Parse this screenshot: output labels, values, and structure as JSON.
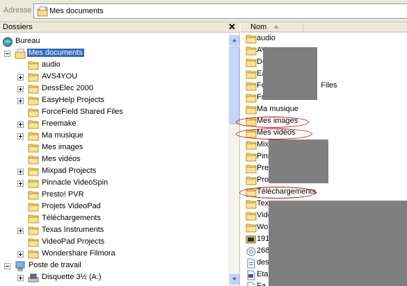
{
  "address": {
    "label": "Adresse",
    "path": "Mes documents"
  },
  "folders_pane": {
    "title": "Dossiers",
    "close": "✕"
  },
  "tree": [
    {
      "label": "Bureau",
      "icon": "desktop-icon",
      "expander": "none",
      "level": 0
    },
    {
      "label": "Mes documents",
      "icon": "my-documents-icon",
      "expander": "minus",
      "level": 1,
      "selected": true
    },
    {
      "label": "audio",
      "icon": "folder-icon",
      "expander": "none",
      "level": 2
    },
    {
      "label": "AVS4YOU",
      "icon": "folder-icon",
      "expander": "plus",
      "level": 2
    },
    {
      "label": "DessElec 2000",
      "icon": "folder-icon",
      "expander": "plus",
      "level": 2
    },
    {
      "label": "EasyHelp Projects",
      "icon": "folder-icon",
      "expander": "plus",
      "level": 2
    },
    {
      "label": "ForceField Shared Files",
      "icon": "folder-icon",
      "expander": "none",
      "level": 2
    },
    {
      "label": "Freemake",
      "icon": "folder-icon",
      "expander": "plus",
      "level": 2
    },
    {
      "label": "Ma musique",
      "icon": "music-folder-icon",
      "expander": "plus",
      "level": 2
    },
    {
      "label": "Mes images",
      "icon": "pictures-folder-icon",
      "expander": "none",
      "level": 2
    },
    {
      "label": "Mes vidéos",
      "icon": "videos-folder-icon",
      "expander": "none",
      "level": 2
    },
    {
      "label": "Mixpad Projects",
      "icon": "folder-icon",
      "expander": "plus",
      "level": 2
    },
    {
      "label": "Pinnacle VideoSpin",
      "icon": "folder-icon",
      "expander": "plus",
      "level": 2
    },
    {
      "label": "Presto! PVR",
      "icon": "folder-icon",
      "expander": "none",
      "level": 2
    },
    {
      "label": "Projets VideoPad",
      "icon": "folder-icon",
      "expander": "none",
      "level": 2
    },
    {
      "label": "Téléchargements",
      "icon": "folder-icon",
      "expander": "none",
      "level": 2
    },
    {
      "label": "Texas Instruments",
      "icon": "folder-icon",
      "expander": "plus",
      "level": 2
    },
    {
      "label": "VideoPad Projects",
      "icon": "folder-icon",
      "expander": "none",
      "level": 2
    },
    {
      "label": "Wondershare Filmora",
      "icon": "folder-icon",
      "expander": "plus",
      "level": 2
    },
    {
      "label": "Poste de travail",
      "icon": "computer-icon",
      "expander": "minus",
      "level": 1
    },
    {
      "label": "Disquette 3½ (A:)",
      "icon": "floppy-drive-icon",
      "expander": "plus",
      "level": 2
    }
  ],
  "list_header": {
    "name_col": "Nom"
  },
  "list": [
    {
      "label": "audio",
      "icon": "folder-icon"
    },
    {
      "label": "AV",
      "icon": "folder-icon"
    },
    {
      "label": "De",
      "icon": "folder-icon"
    },
    {
      "label": "Ea",
      "icon": "folder-icon"
    },
    {
      "label": "Fo                          Files",
      "icon": "folder-icon"
    },
    {
      "label": "Freemake",
      "icon": "folder-icon"
    },
    {
      "label": "Ma musique",
      "icon": "music-folder-icon"
    },
    {
      "label": "Mes images",
      "icon": "pictures-folder-icon"
    },
    {
      "label": "Mes vidéos",
      "icon": "videos-folder-icon"
    },
    {
      "label": "Mix",
      "icon": "folder-icon"
    },
    {
      "label": "Pinn",
      "icon": "folder-icon"
    },
    {
      "label": "Pre",
      "icon": "folder-icon"
    },
    {
      "label": "Pro",
      "icon": "folder-icon"
    },
    {
      "label": "Téléchargements",
      "icon": "folder-icon"
    },
    {
      "label": "Tex",
      "icon": "folder-icon"
    },
    {
      "label": "Vide",
      "icon": "folder-icon"
    },
    {
      "label": "Wo",
      "icon": "folder-icon"
    },
    {
      "label": "191",
      "icon": "media-file-icon"
    },
    {
      "label": "268",
      "icon": "cd-file-icon"
    },
    {
      "label": "des",
      "icon": "document-file-icon"
    },
    {
      "label": "Eta",
      "icon": "text-file-icon"
    },
    {
      "label": "Fa",
      "icon": "document-file-icon"
    }
  ],
  "colors": {
    "selection": "#316ac5",
    "annotation_ellipse": "#c00000",
    "redaction": "#7f7f7f",
    "folder_yellow": "#f6d774"
  }
}
